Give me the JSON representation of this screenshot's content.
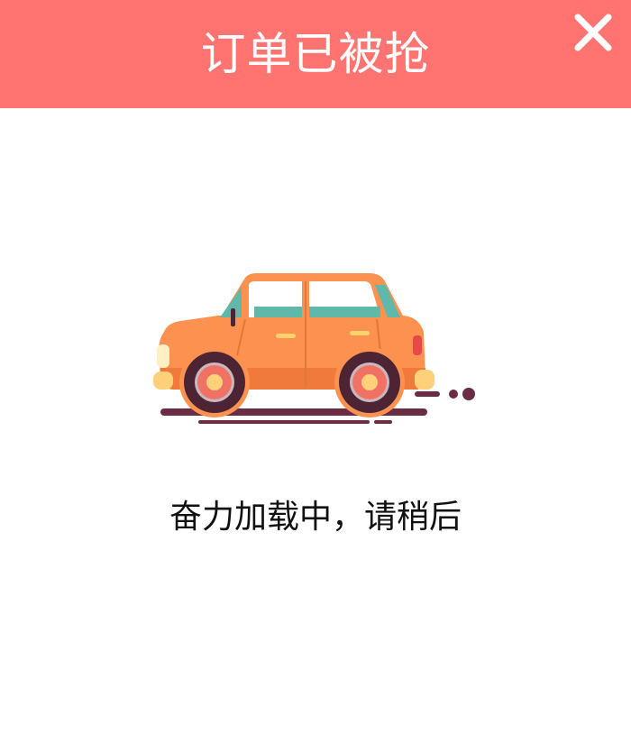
{
  "dialog": {
    "title": "订单已被抢",
    "close_icon": "close-icon",
    "illustration_icon": "car-icon",
    "loading_text": "奋力加载中，请稍后"
  },
  "colors": {
    "header_bg": "#ff7470",
    "header_text": "#ffffff",
    "body_text": "#111111",
    "car_body": "#fd9150",
    "car_window": "#5fb8aa",
    "car_wheel": "#4d2433"
  }
}
